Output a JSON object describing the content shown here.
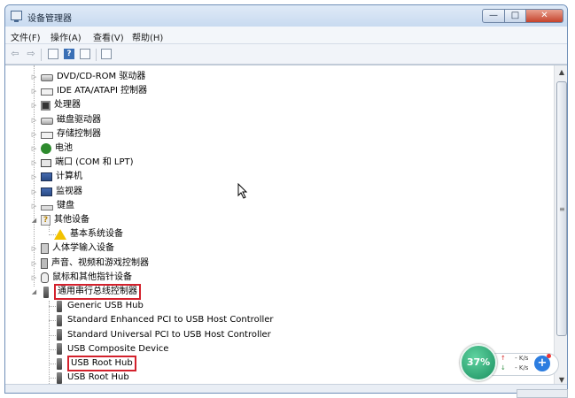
{
  "window": {
    "title": "设备管理器",
    "caption": {
      "minimize": "—",
      "maximize": "□",
      "close": "✕"
    }
  },
  "menubar": [
    {
      "label": "文件(F)"
    },
    {
      "label": "操作(A)"
    },
    {
      "label": "查看(V)"
    },
    {
      "label": "帮助(H)"
    }
  ],
  "toolbar": {
    "back": "⇦",
    "forward": "⇨",
    "help": "?"
  },
  "tree": [
    {
      "label": "DVD/CD-ROM 驱动器",
      "icon": "disk-icon",
      "expander": "▷"
    },
    {
      "label": "IDE ATA/ATAPI 控制器",
      "icon": "controller-icon",
      "expander": "▷"
    },
    {
      "label": "处理器",
      "icon": "cpu-icon",
      "expander": "▷"
    },
    {
      "label": "磁盘驱动器",
      "icon": "disk-drive-icon",
      "expander": "▷"
    },
    {
      "label": "存储控制器",
      "icon": "storage-icon",
      "expander": "▷"
    },
    {
      "label": "电池",
      "icon": "battery-icon",
      "expander": "▷"
    },
    {
      "label": "端口 (COM 和 LPT)",
      "icon": "port-icon",
      "expander": "▷"
    },
    {
      "label": "计算机",
      "icon": "computer-icon",
      "expander": "▷"
    },
    {
      "label": "监视器",
      "icon": "monitor-icon",
      "expander": "▷"
    },
    {
      "label": "键盘",
      "icon": "keyboard-icon",
      "expander": "▷"
    },
    {
      "label": "其他设备",
      "icon": "unknown-device-icon",
      "expander": "◢"
    },
    {
      "label": "基本系统设备",
      "icon": "warning-icon",
      "child": true
    },
    {
      "label": "人体学输入设备",
      "icon": "hid-icon",
      "expander": "▷"
    },
    {
      "label": "声音、视频和游戏控制器",
      "icon": "sound-icon",
      "expander": "▷"
    },
    {
      "label": "鼠标和其他指针设备",
      "icon": "mouse-icon",
      "expander": "▷"
    },
    {
      "label": "通用串行总线控制器",
      "icon": "usb-icon",
      "expander": "◢",
      "highlight": true
    },
    {
      "label": "Generic USB Hub",
      "icon": "usb-icon",
      "child": true
    },
    {
      "label": "Standard Enhanced PCI to USB Host Controller",
      "icon": "usb-icon",
      "child": true
    },
    {
      "label": "Standard Universal PCI to USB Host Controller",
      "icon": "usb-icon",
      "child": true
    },
    {
      "label": "USB Composite Device",
      "icon": "usb-icon",
      "child": true
    },
    {
      "label": "USB Root Hub",
      "icon": "usb-icon",
      "child": true,
      "highlight": true
    },
    {
      "label": "USB Root Hub",
      "icon": "usb-icon",
      "child": true
    }
  ],
  "net_widget": {
    "percent": "37%",
    "upload_arrow": "↑",
    "upload": "- K/s",
    "download_arrow": "↓",
    "download": "- K/s",
    "plus": "+"
  },
  "scrollbar": {
    "up": "▲",
    "down": "▼",
    "grip": "≡"
  }
}
